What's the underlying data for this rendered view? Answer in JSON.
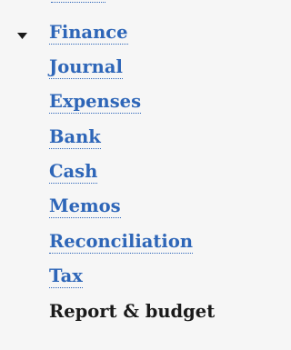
{
  "nav": {
    "section": {
      "label": "Finance",
      "expanded": true,
      "toggle_icon": "caret-down-icon"
    },
    "items": [
      {
        "label": "Journal"
      },
      {
        "label": "Expenses"
      },
      {
        "label": "Bank"
      },
      {
        "label": "Cash"
      },
      {
        "label": "Memos"
      },
      {
        "label": "Reconciliation"
      },
      {
        "label": "Tax"
      },
      {
        "label": "Report & budget",
        "current": true
      }
    ]
  },
  "colors": {
    "link": "#2e66b8",
    "current_text": "#1a1a1a",
    "background": "#f6f6f6"
  }
}
